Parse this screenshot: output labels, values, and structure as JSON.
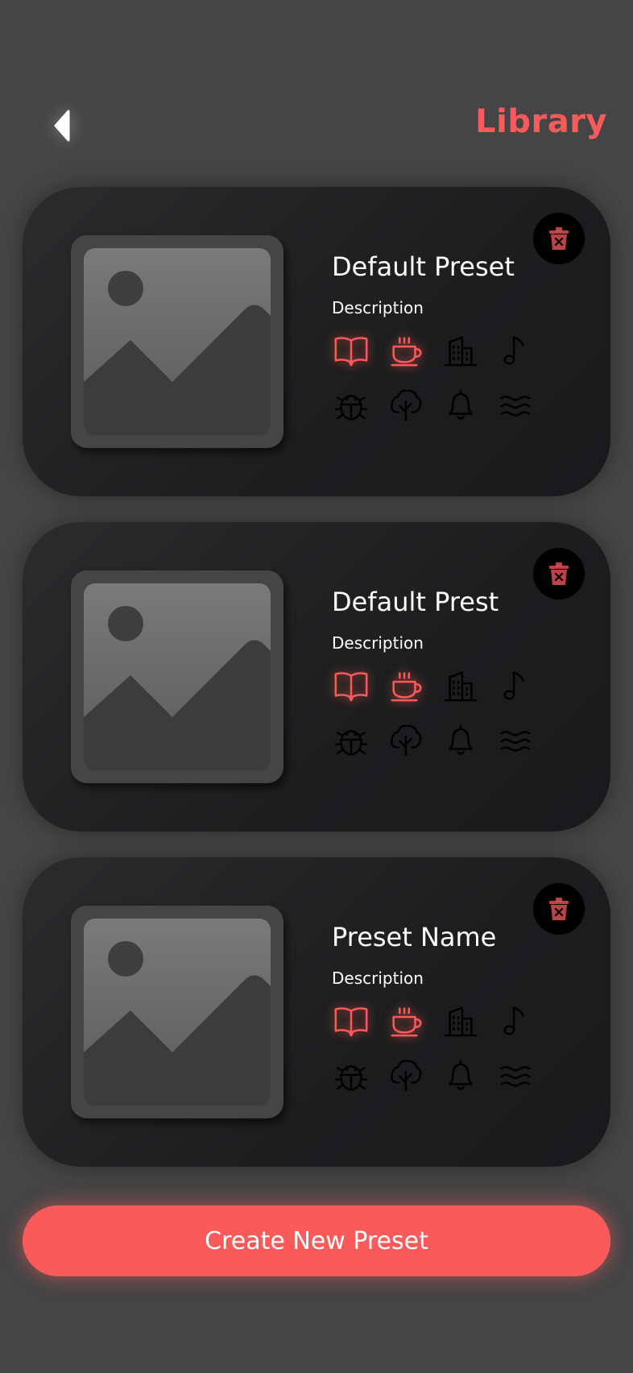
{
  "header": {
    "title": "Library",
    "accent": "#fb5a5a",
    "back_icon": "back-arrow-icon"
  },
  "presets": [
    {
      "name": "Default Preset",
      "description": "Description",
      "icons": [
        {
          "name": "book-icon",
          "active": true
        },
        {
          "name": "coffee-icon",
          "active": true
        },
        {
          "name": "city-icon",
          "active": false
        },
        {
          "name": "music-note-icon",
          "active": false
        },
        {
          "name": "bug-icon",
          "active": false
        },
        {
          "name": "tree-icon",
          "active": false
        },
        {
          "name": "bell-icon",
          "active": false
        },
        {
          "name": "waves-icon",
          "active": false
        }
      ]
    },
    {
      "name": "Default Prest",
      "description": "Description",
      "icons": [
        {
          "name": "book-icon",
          "active": true
        },
        {
          "name": "coffee-icon",
          "active": true
        },
        {
          "name": "city-icon",
          "active": false
        },
        {
          "name": "music-note-icon",
          "active": false
        },
        {
          "name": "bug-icon",
          "active": false
        },
        {
          "name": "tree-icon",
          "active": false
        },
        {
          "name": "bell-icon",
          "active": false
        },
        {
          "name": "waves-icon",
          "active": false
        }
      ]
    },
    {
      "name": "Preset Name",
      "description": "Description",
      "icons": [
        {
          "name": "book-icon",
          "active": true
        },
        {
          "name": "coffee-icon",
          "active": true
        },
        {
          "name": "city-icon",
          "active": false
        },
        {
          "name": "music-note-icon",
          "active": false
        },
        {
          "name": "bug-icon",
          "active": false
        },
        {
          "name": "tree-icon",
          "active": false
        },
        {
          "name": "bell-icon",
          "active": false
        },
        {
          "name": "waves-icon",
          "active": false
        }
      ]
    }
  ],
  "create_button": {
    "label": "Create New Preset"
  }
}
